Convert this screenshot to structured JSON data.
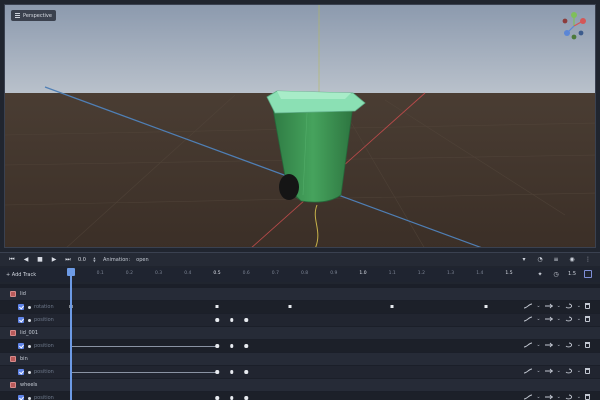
{
  "viewport": {
    "mode_label": "Perspective"
  },
  "playback": {
    "buttons": [
      "rewind-to-start",
      "play-backwards",
      "stop",
      "play",
      "play-to-end"
    ],
    "time_value": "0.0",
    "animation_label": "Animation:",
    "animation_name": "open"
  },
  "timeline": {
    "add_track_label": "+ Add Track",
    "ticks": [
      {
        "value": "0.0",
        "major": true
      },
      {
        "value": "0.1",
        "major": false
      },
      {
        "value": "0.2",
        "major": false
      },
      {
        "value": "0.3",
        "major": false
      },
      {
        "value": "0.4",
        "major": false
      },
      {
        "value": "0.5",
        "major": true
      },
      {
        "value": "0.6",
        "major": false
      },
      {
        "value": "0.7",
        "major": false
      },
      {
        "value": "0.8",
        "major": false
      },
      {
        "value": "0.9",
        "major": false
      },
      {
        "value": "1.0",
        "major": true
      },
      {
        "value": "1.1",
        "major": false
      },
      {
        "value": "1.2",
        "major": false
      },
      {
        "value": "1.3",
        "major": false
      },
      {
        "value": "1.4",
        "major": false
      },
      {
        "value": "1.5",
        "major": true
      }
    ],
    "length_value": "1.5",
    "zoom_value": "0.0"
  },
  "tracks": [
    {
      "node": "lid",
      "props": [
        {
          "label": "rotation",
          "keys": [
            0.0,
            0.5,
            0.75,
            1.1,
            1.42
          ],
          "style": "sq"
        },
        {
          "label": "position",
          "keys": [
            0.5,
            0.55,
            0.6
          ],
          "style": "rd"
        }
      ]
    },
    {
      "node": "lid_001",
      "props": [
        {
          "label": "position",
          "keys": [
            0.5,
            0.55,
            0.6
          ],
          "style": "rd",
          "line_from": 0.0
        }
      ]
    },
    {
      "node": "bin",
      "props": [
        {
          "label": "position",
          "keys": [
            0.5,
            0.55,
            0.6
          ],
          "style": "rd",
          "line_from": 0.0
        }
      ]
    },
    {
      "node": "wheels",
      "props": [
        {
          "label": "position",
          "keys": [
            0.5,
            0.55,
            0.6
          ],
          "style": "rd"
        }
      ]
    }
  ],
  "colors": {
    "accent": "#6d9be6",
    "checkbox": "#5f84e8",
    "node_icon": "#b85a5a",
    "bin_body": "#3f9a57",
    "bin_lid": "#8be0b4"
  },
  "icons": [
    "hamburger-icon",
    "axis-gizmo-icon",
    "loop-icon",
    "snap-icon",
    "clock-icon",
    "curve-icon",
    "interp-icon",
    "trash-icon"
  ]
}
